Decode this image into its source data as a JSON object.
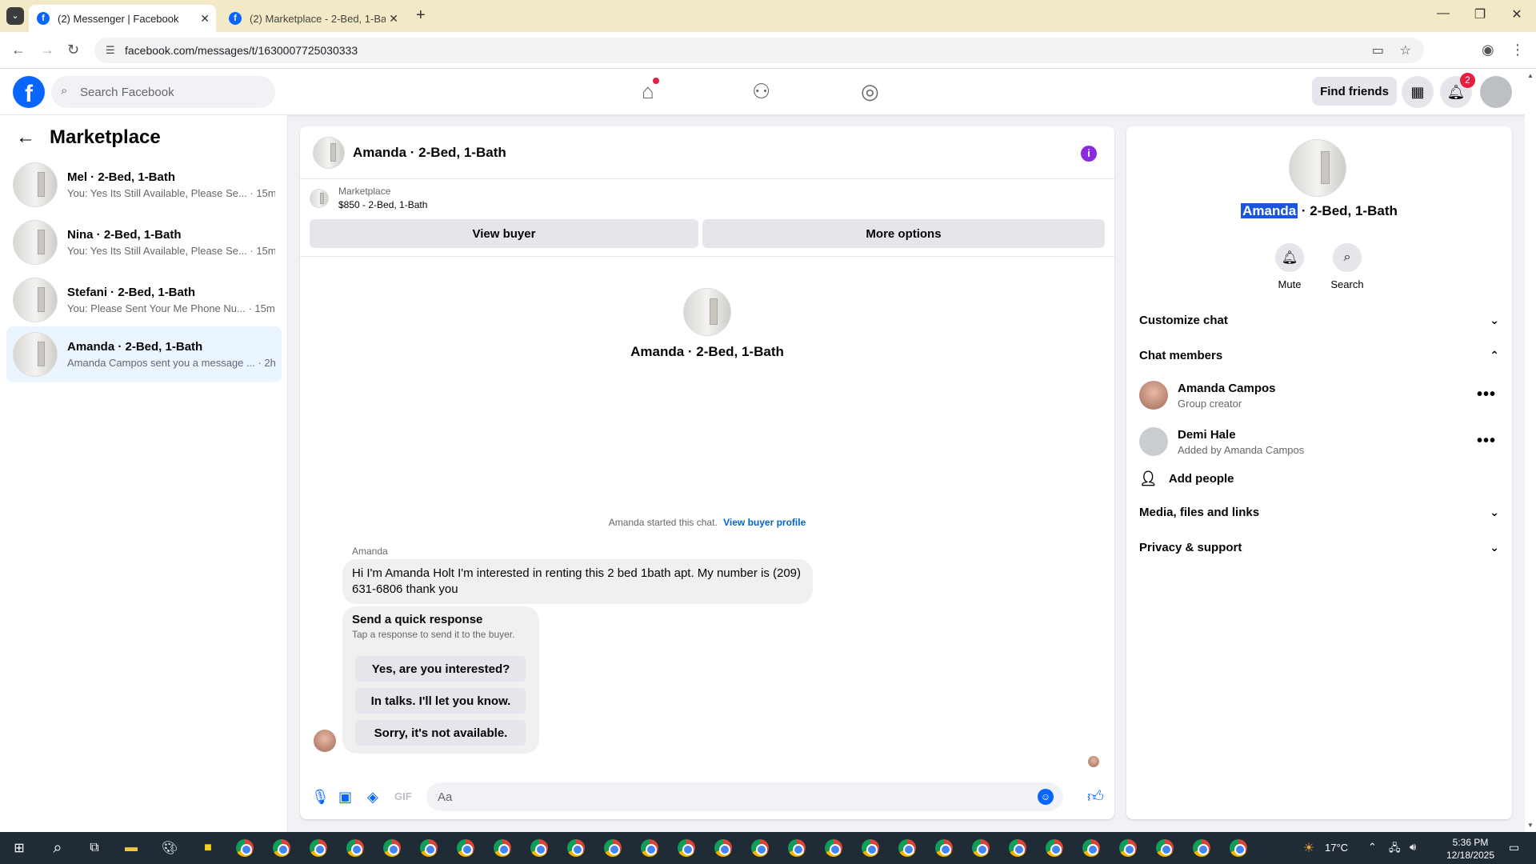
{
  "browser": {
    "tabs": [
      {
        "title": "(2) Messenger | Facebook",
        "active": true
      },
      {
        "title": "(2) Marketplace - 2-Bed, 1-Bath",
        "active": false
      }
    ],
    "url": "facebook.com/messages/t/1630007725030333"
  },
  "header": {
    "logo": "f",
    "search_placeholder": "Search Facebook",
    "find_friends": "Find friends",
    "notification_count": "2"
  },
  "sidebar": {
    "title": "Marketplace",
    "conversations": [
      {
        "name": "Mel · 2-Bed, 1-Bath",
        "preview": "You: Yes Its Still Available, Please Se... · 15m"
      },
      {
        "name": "Nina · 2-Bed, 1-Bath",
        "preview": "You: Yes Its Still Available, Please Se... · 15m"
      },
      {
        "name": "Stefani · 2-Bed, 1-Bath",
        "preview": "You: Please Sent Your Me Phone Nu... · 15m"
      },
      {
        "name": "Amanda · 2-Bed, 1-Bath",
        "preview": "Amanda Campos sent you a message ... · 2h"
      }
    ]
  },
  "chat": {
    "title": "Amanda · 2-Bed, 1-Bath",
    "marketplace_label": "Marketplace",
    "listing": "$850 - 2-Bed, 1-Bath",
    "view_buyer": "View buyer",
    "more_options": "More options",
    "center_name": "Amanda · 2-Bed, 1-Bath",
    "started_text": "Amanda started this chat.",
    "view_buyer_profile": "View buyer profile",
    "sender": "Amanda",
    "message": "Hi I'm Amanda Holt I'm interested in renting this 2 bed 1bath apt. My number is (209) 631-6806 thank you",
    "quick_response_title": "Send a quick response",
    "quick_response_sub": "Tap a response to send it to the buyer.",
    "quick_responses": [
      "Yes, are you interested?",
      "In talks. I'll let you know.",
      "Sorry, it's not available."
    ],
    "composer_placeholder": "Aa"
  },
  "info": {
    "title_highlight": "Amanda",
    "title_rest": " · 2-Bed, 1-Bath",
    "mute": "Mute",
    "search": "Search",
    "customize_chat": "Customize chat",
    "chat_members": "Chat members",
    "members": [
      {
        "name": "Amanda Campos",
        "sub": "Group creator"
      },
      {
        "name": "Demi Hale",
        "sub": "Added by Amanda Campos"
      }
    ],
    "add_people": "Add people",
    "media": "Media, files and links",
    "privacy": "Privacy & support"
  },
  "taskbar": {
    "temperature": "17°C",
    "time": "5:36 PM",
    "date": "12/18/2025"
  },
  "colors": {
    "brand": "#0866ff",
    "tabbar": "#f2eac6",
    "taskbar": "#1f2b35"
  }
}
